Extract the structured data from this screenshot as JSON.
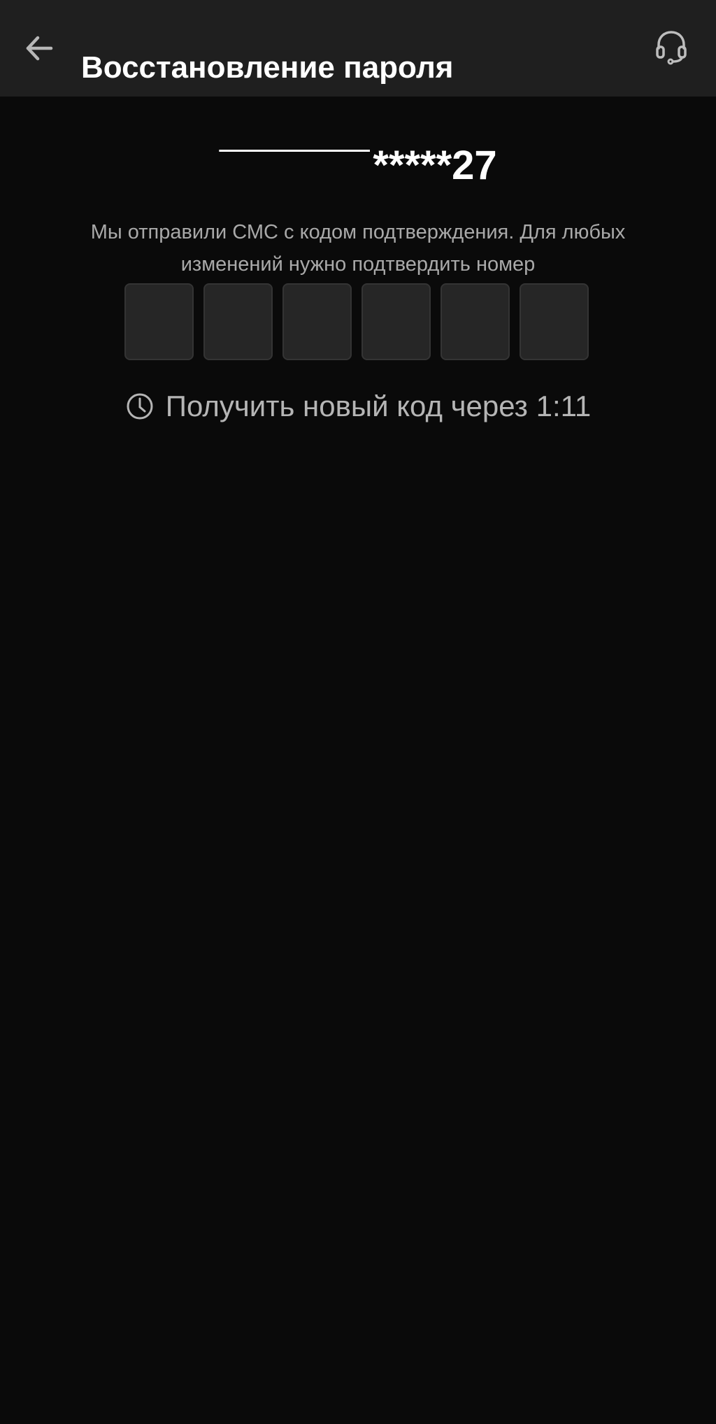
{
  "header": {
    "title": "Восстановление пароля",
    "back_icon": "arrow-left-icon",
    "support_icon": "headset-icon"
  },
  "verification": {
    "phone_visible_part": "*****27",
    "instruction": "Мы отправили СМС с кодом подтверждения. Для любых изменений нужно подтвердить номер",
    "code_length": 6,
    "code_digits": [
      "",
      "",
      "",
      "",
      "",
      ""
    ],
    "resend_text": "Получить новый код через 1:11",
    "resend_icon": "clock-icon"
  },
  "colors": {
    "background": "#0a0a0a",
    "header_background": "#1f1f1f",
    "code_box": "#262626",
    "text_primary": "#ffffff",
    "text_secondary": "#a9a9a9"
  }
}
